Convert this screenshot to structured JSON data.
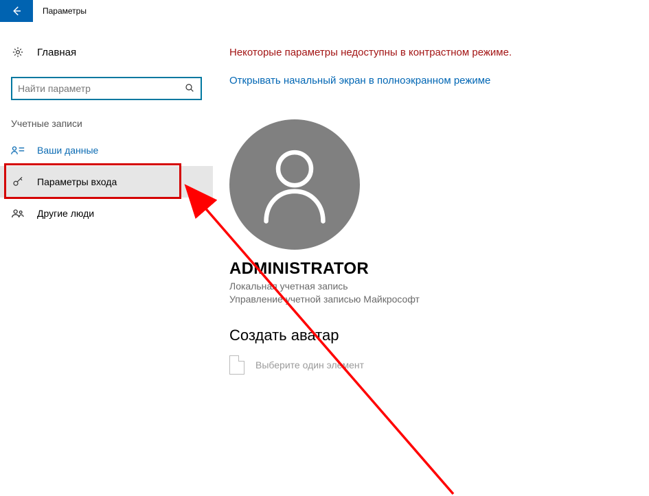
{
  "titlebar": {
    "title": "Параметры"
  },
  "sidebar": {
    "home_label": "Главная",
    "search_placeholder": "Найти параметр",
    "section_label": "Учетные записи",
    "items": [
      {
        "label": "Ваши данные"
      },
      {
        "label": "Параметры входа"
      },
      {
        "label": "Другие люди"
      }
    ]
  },
  "main": {
    "warning": "Некоторые параметры недоступны в контрастном режиме.",
    "link": "Открывать начальный экран в полноэкранном режиме",
    "user_name": "ADMINISTRATOR",
    "account_type": "Локальная учетная запись",
    "manage_link": "Управление учетной записью Майкрософт",
    "create_avatar_heading": "Создать аватар",
    "pick_text": "Выберите один элемент"
  }
}
